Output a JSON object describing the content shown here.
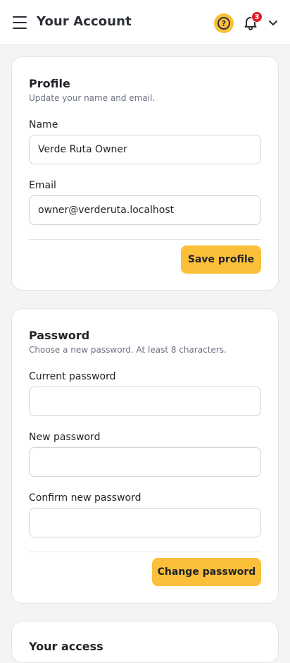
{
  "header": {
    "title": "Your Account",
    "notification_count": "3",
    "icons": [
      "menu-icon",
      "help-icon",
      "bell-icon",
      "chevron-down-icon"
    ],
    "accent_color": "#fbbf3a",
    "badge_color": "#e11d2a"
  },
  "profile": {
    "title": "Profile",
    "subtitle": "Update your name and email.",
    "name_label": "Name",
    "name_value": "Verde Ruta Owner",
    "email_label": "Email",
    "email_value": "owner@verderuta.localhost",
    "save_label": "Save profile"
  },
  "password": {
    "title": "Password",
    "subtitle": "Choose a new password. At least 8 characters.",
    "current_label": "Current password",
    "current_value": "",
    "new_label": "New password",
    "new_value": "",
    "confirm_label": "Confirm new password",
    "confirm_value": "",
    "change_label": "Change password"
  },
  "access": {
    "title": "Your access"
  }
}
